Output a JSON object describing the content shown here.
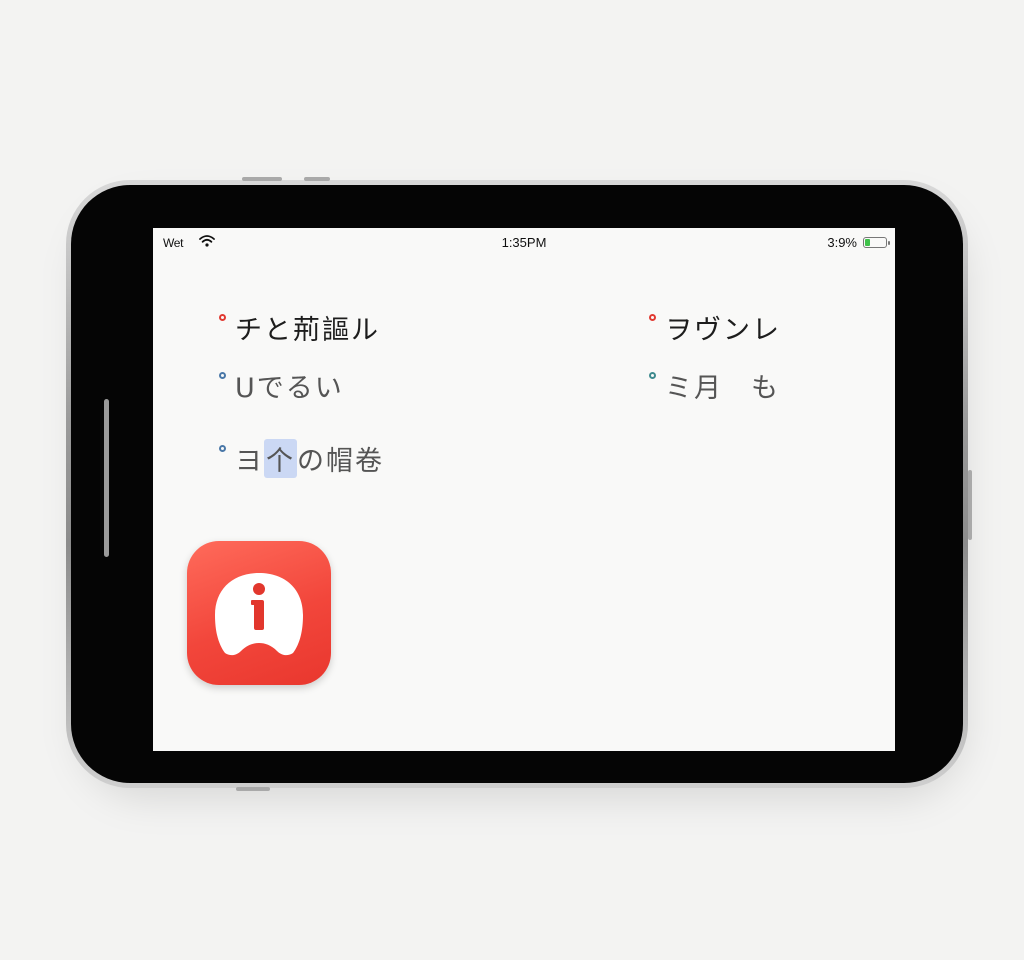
{
  "status_bar": {
    "carrier": "Wet",
    "time": "1:35PM",
    "battery_percent": "3:9%",
    "battery_level": 0.25,
    "battery_color": "#3fc24a"
  },
  "menu": {
    "left": [
      {
        "text": "チと荊謳ル",
        "bullet_color": "#e13a32"
      },
      {
        "text": "Uでるい",
        "bullet_color": "#4a78a8"
      },
      {
        "text_before": "ヨ",
        "text_highlight": "个",
        "text_after": "の帽卷",
        "bullet_color": "#4a78a8"
      }
    ],
    "right": [
      {
        "text": "ヲヴンレ",
        "bullet_color": "#e13a32"
      },
      {
        "text_a": "ミ月",
        "text_b": "も",
        "bullet_color": "#3e8a8e"
      }
    ]
  },
  "app_icon": {
    "icon": "info-icon",
    "glyph": "i",
    "accent": "#f2463b"
  }
}
